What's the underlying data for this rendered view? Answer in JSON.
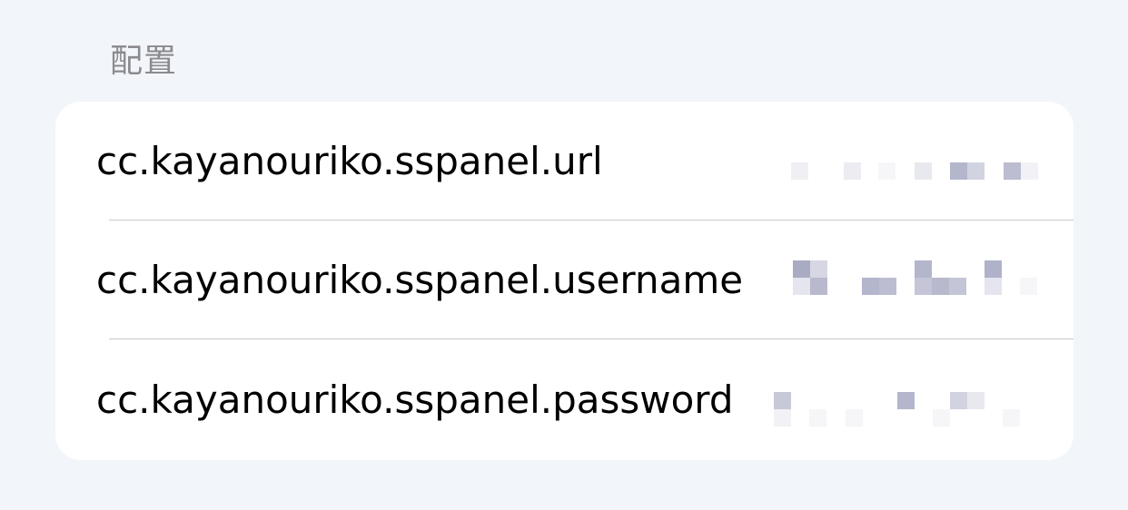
{
  "section": {
    "title": "配置"
  },
  "settings": [
    {
      "key": "cc.kayanouriko.sspanel.url",
      "value_redacted": true
    },
    {
      "key": "cc.kayanouriko.sspanel.username",
      "value_redacted": true
    },
    {
      "key": "cc.kayanouriko.sspanel.password",
      "value_redacted": true
    }
  ],
  "colors": {
    "background": "#f2f5f9",
    "card": "#ffffff",
    "key_text": "#000000",
    "header_text": "#8a8a8f",
    "divider": "#c8c8cc",
    "redaction": "#b4b6cc"
  }
}
